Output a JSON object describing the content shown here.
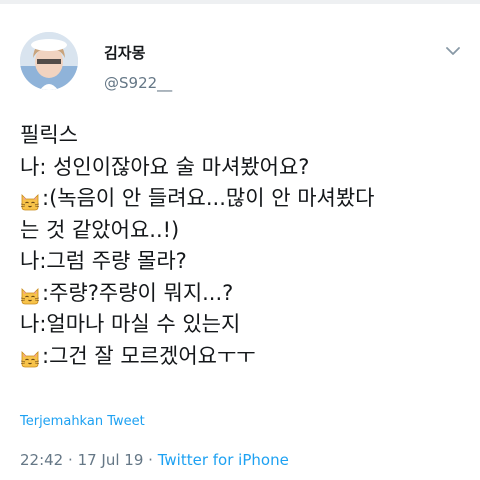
{
  "author": {
    "display_name": "김자몽",
    "handle": "@S922__"
  },
  "icons": {
    "menu": "chevron-down-icon",
    "speaker": "cat-face-icon",
    "avatar": "avatar-photo"
  },
  "tweet": {
    "lines": [
      {
        "prefix": "",
        "text": "필릭스"
      },
      {
        "prefix": "",
        "text": "나: 성인이잖아요 술 마셔봤어요?"
      },
      {
        "prefix": "cat",
        "text": ":(녹음이 안 들려요...많이 안 마셔봤다"
      },
      {
        "prefix": "",
        "text": "는 것 같았어요..!)"
      },
      {
        "prefix": "",
        "text": "나:그럼 주량 몰라?"
      },
      {
        "prefix": "cat",
        "text": ":주량?주량이 뭐지...?"
      },
      {
        "prefix": "",
        "text": "나:얼마나 마실 수 있는지"
      },
      {
        "prefix": "cat",
        "text": ":그건 잘 모르겠어요ㅜㅜ"
      }
    ]
  },
  "translate_label": "Terjemahkan Tweet",
  "meta": {
    "time": "22:42",
    "separator1": "·",
    "date": "17 Jul 19",
    "separator2": "·",
    "source": "Twitter for iPhone"
  },
  "colors": {
    "link": "#1da1f2",
    "muted": "#657786",
    "text": "#14171a"
  }
}
